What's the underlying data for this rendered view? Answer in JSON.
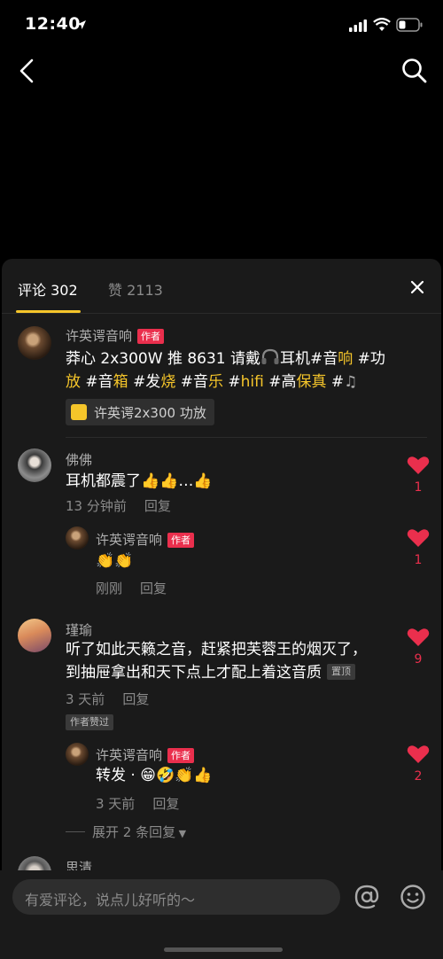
{
  "status": {
    "time": "12:40"
  },
  "tabs": {
    "comments_label": "评论",
    "comments_count": "302",
    "likes_label": "赞",
    "likes_count": "2113"
  },
  "comments": [
    {
      "user": "许英谔音响",
      "badge": "作者",
      "text_line1": [
        "莽心 2x300W 推 8631 请戴",
        "耳机",
        "#音",
        "响",
        " #功"
      ],
      "text_line2": [
        "放",
        "#音",
        "箱",
        "#发",
        "烧",
        "#音",
        "乐",
        "#",
        "hifi",
        "#高",
        "保真",
        "#"
      ],
      "product_label": "许英谔2x300 功放"
    },
    {
      "user": "佛佛",
      "text": "耳机都震了",
      "time": "13 分钟前",
      "reply": "回复",
      "likes": "1",
      "reply_item": {
        "user": "许英谔音响",
        "badge": "作者",
        "time": "刚刚",
        "reply": "回复",
        "likes": "1"
      }
    },
    {
      "user": "瑾瑜",
      "text_line1": "听了如此天籁之音，赶紧把芙蓉王的烟灭了，",
      "text_line2": "到抽屉拿出和天下点上才配上着这音质",
      "pin": "置顶",
      "time": "3 天前",
      "reply": "回复",
      "author_liked": "作者赞过",
      "likes": "9",
      "reply_item": {
        "user": "许英谔音响",
        "badge": "作者",
        "text": "转发 ·",
        "time": "3 天前",
        "reply": "回复",
        "likes": "2"
      },
      "expand": "展开 2 条回复"
    },
    {
      "user": "思清"
    }
  ],
  "input": {
    "placeholder": "有爱评论，说点儿好听的～"
  },
  "colors": {
    "accent": "#f5c52a",
    "like": "#ea2f4d",
    "sheet": "#1a1a1a"
  }
}
